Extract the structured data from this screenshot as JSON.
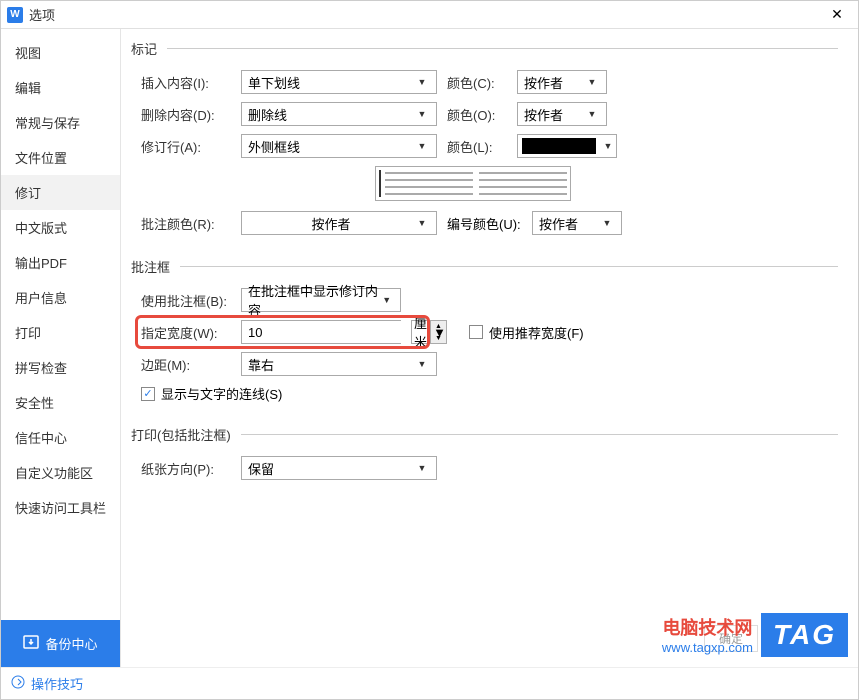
{
  "titlebar": {
    "app_icon_letter": "W",
    "title": "选项"
  },
  "sidebar": {
    "items": [
      {
        "label": "视图"
      },
      {
        "label": "编辑"
      },
      {
        "label": "常规与保存"
      },
      {
        "label": "文件位置"
      },
      {
        "label": "修订"
      },
      {
        "label": "中文版式"
      },
      {
        "label": "输出PDF"
      },
      {
        "label": "用户信息"
      },
      {
        "label": "打印"
      },
      {
        "label": "拼写检查"
      },
      {
        "label": "安全性"
      },
      {
        "label": "信任中心"
      },
      {
        "label": "自定义功能区"
      },
      {
        "label": "快速访问工具栏"
      }
    ],
    "backup_label": "备份中心"
  },
  "tipbar": {
    "label": "操作技巧"
  },
  "section_mark": {
    "legend": "标记",
    "insert_label": "插入内容(I):",
    "insert_value": "单下划线",
    "delete_label": "删除内容(D):",
    "delete_value": "删除线",
    "revise_label": "修订行(A):",
    "revise_value": "外侧框线",
    "color_label": "颜色(C):",
    "color_value": "按作者",
    "color_label2": "颜色(O):",
    "color_value2": "按作者",
    "color_label3": "颜色(L):",
    "annot_color_label": "批注颜色(R):",
    "annot_color_value": "按作者",
    "num_color_label": "编号颜色(U):",
    "num_color_value": "按作者"
  },
  "section_box": {
    "legend": "批注框",
    "use_label": "使用批注框(B):",
    "use_value": "在批注框中显示修订内容",
    "width_label": "指定宽度(W):",
    "width_value": "10",
    "unit_value": "厘米",
    "rec_width_label": "使用推荐宽度(F)",
    "margin_label": "边距(M):",
    "margin_value": "靠右",
    "show_line_label": "显示与文字的连线(S)",
    "show_line_checked": true
  },
  "section_print": {
    "legend": "打印(包括批注框)",
    "orient_label": "纸张方向(P):",
    "orient_value": "保留"
  },
  "watermark": {
    "line1": "电脑技术网",
    "line2": "www.tagxp.com",
    "tag": "TAG"
  },
  "ok_btn": "确定"
}
